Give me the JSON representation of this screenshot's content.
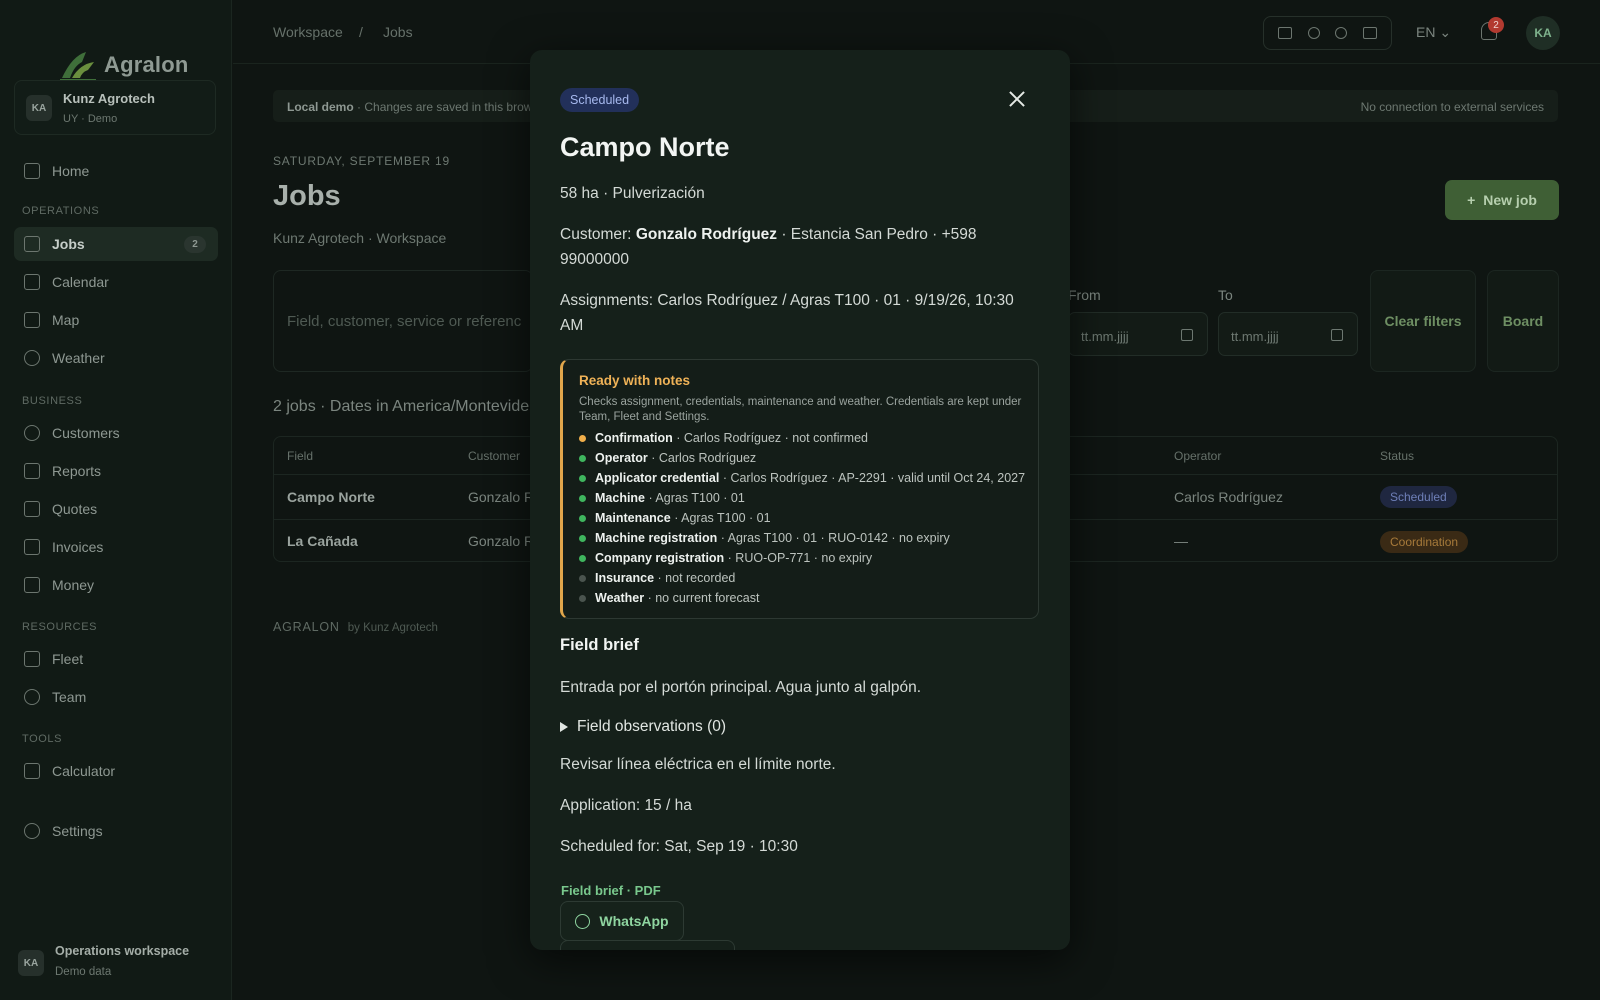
{
  "app": {
    "logo_text": "Agralon",
    "org": {
      "initials": "KA",
      "name": "Kunz Agrotech",
      "sub": "UY · Demo"
    }
  },
  "sidebar": {
    "home": "Home",
    "sections": {
      "operations": "OPERATIONS",
      "business": "BUSINESS",
      "resources": "RESOURCES",
      "tools": "TOOLS"
    },
    "operations": [
      {
        "label": "Jobs",
        "badge": "2"
      },
      {
        "label": "Calendar"
      },
      {
        "label": "Map"
      },
      {
        "label": "Weather"
      }
    ],
    "business": [
      {
        "label": "Customers"
      },
      {
        "label": "Reports"
      },
      {
        "label": "Quotes"
      },
      {
        "label": "Invoices"
      },
      {
        "label": "Money"
      }
    ],
    "resources": [
      {
        "label": "Fleet"
      },
      {
        "label": "Team"
      }
    ],
    "tools": [
      {
        "label": "Calculator"
      }
    ],
    "settings": "Settings",
    "footer": {
      "initials": "KA",
      "title": "Operations workspace",
      "sub": "Demo data"
    }
  },
  "topbar": {
    "breadcrumb": [
      "Workspace",
      "/",
      "Jobs"
    ],
    "lang": "EN",
    "notifications": "2",
    "user_initials": "KA"
  },
  "page": {
    "banner_bold": "Local demo",
    "banner_text": " · Changes are saved in this brows",
    "banner_right": "No connection to external services",
    "date": "SATURDAY, SEPTEMBER 19",
    "title": "Jobs",
    "subtitle": "Kunz Agrotech · Workspace",
    "new_job": "New job",
    "search_placeholder": "Field, customer, service or referenc",
    "from_label": "From",
    "to_label": "To",
    "date_placeholder": "tt.mm.jjjj",
    "clear_filters": "Clear filters",
    "board": "Board",
    "count_line": "2 jobs · Dates in America/Montevide",
    "table": {
      "headers": [
        "Field",
        "Customer",
        "Operator",
        "Status"
      ],
      "rows": [
        {
          "field": "Campo Norte",
          "customer": "Gonzalo Ro",
          "operator": "Carlos Rodríguez",
          "status": "Scheduled"
        },
        {
          "field": "La Cañada",
          "customer": "Gonzalo Ro",
          "operator": "—",
          "status": "Coordination"
        }
      ]
    },
    "footer_brand": "AGRALON",
    "footer_by": "by Kunz Agrotech"
  },
  "modal": {
    "status": "Scheduled",
    "title": "Campo Norte",
    "summary": "58 ha · Pulverización",
    "customer_label": "Customer: ",
    "customer_name": "Gonzalo Rodríguez",
    "customer_rest": " · Estancia San Pedro · +598 99000000",
    "assignments": "Assignments: Carlos Rodríguez / Agras T100 · 01 · 9/19/26, 10:30 AM",
    "readiness": {
      "title": "Ready with notes",
      "description": "Checks assignment, credentials, maintenance and weather. Credentials are kept under Team, Fleet and Settings.",
      "checks": [
        {
          "label": "Confirmation",
          "detail": " · Carlos Rodríguez · not confirmed",
          "state": "warn"
        },
        {
          "label": "Operator",
          "detail": " · Carlos Rodríguez",
          "state": "ok"
        },
        {
          "label": "Applicator credential",
          "detail": " · Carlos Rodríguez · AP-2291 · valid until Oct 24, 2027",
          "state": "ok"
        },
        {
          "label": "Machine",
          "detail": " · Agras T100 · 01",
          "state": "ok"
        },
        {
          "label": "Maintenance",
          "detail": " · Agras T100 · 01",
          "state": "ok"
        },
        {
          "label": "Machine registration",
          "detail": " · Agras T100 · 01 · RUO-0142 · no expiry",
          "state": "ok"
        },
        {
          "label": "Company registration",
          "detail": " · RUO-OP-771 · no expiry",
          "state": "ok"
        },
        {
          "label": "Insurance",
          "detail": " · not recorded",
          "state": "none"
        },
        {
          "label": "Weather",
          "detail": " · no current forecast",
          "state": "none"
        }
      ]
    },
    "field_brief_heading": "Field brief",
    "field_brief_text": "Entrada por el portón principal. Agua junto al galpón.",
    "observations": "Field observations (0)",
    "note": "Revisar línea eléctrica en el límite norte.",
    "application": "Application: 15 / ha",
    "scheduled_for": "Scheduled for: Sat, Sep 19 · 10:30",
    "pdf_link": "Field brief · PDF",
    "whatsapp": "WhatsApp"
  },
  "colors": {
    "accent_green": "#3fb65e",
    "warning": "#e1a64b",
    "scheduled_badge": "#22305a",
    "background": "#0f1512"
  }
}
